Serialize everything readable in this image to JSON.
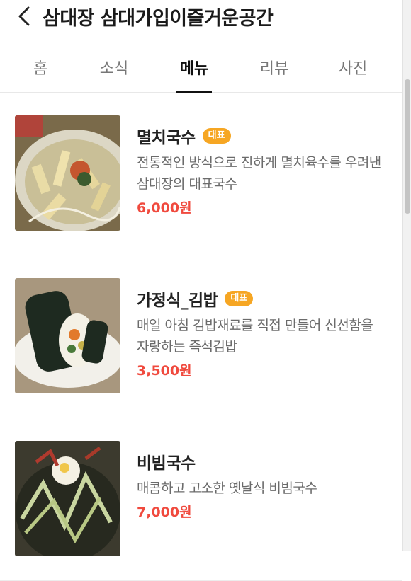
{
  "header": {
    "title": "삼대장 삼대가입이즐거운공간"
  },
  "tabs": [
    {
      "label": "홈",
      "active": false
    },
    {
      "label": "소식",
      "active": false
    },
    {
      "label": "메뉴",
      "active": true
    },
    {
      "label": "리뷰",
      "active": false
    },
    {
      "label": "사진",
      "active": false
    }
  ],
  "menu": [
    {
      "name": "멸치국수",
      "badge": "대표",
      "description": "전통적인 방식으로 진하게 멸치육수를 우려낸 삼대장의 대표국수",
      "price": "6,000원",
      "image": "anchovy-noodle-photo"
    },
    {
      "name": "가정식_김밥",
      "badge": "대표",
      "description": "매일 아침 김밥재료를 직접 만들어 신선함을 자랑하는 즉석김밥",
      "price": "3,500원",
      "image": "gimbap-photo"
    },
    {
      "name": "비빔국수",
      "badge": "",
      "description": "매콤하고 고소한 옛날식 비빔국수",
      "price": "7,000원",
      "image": "bibim-noodle-photo"
    }
  ],
  "colors": {
    "badge": "#f6a623",
    "price": "#f04a3e",
    "active_tab": "#111111"
  },
  "icons": {
    "back": "chevron-left-icon"
  }
}
